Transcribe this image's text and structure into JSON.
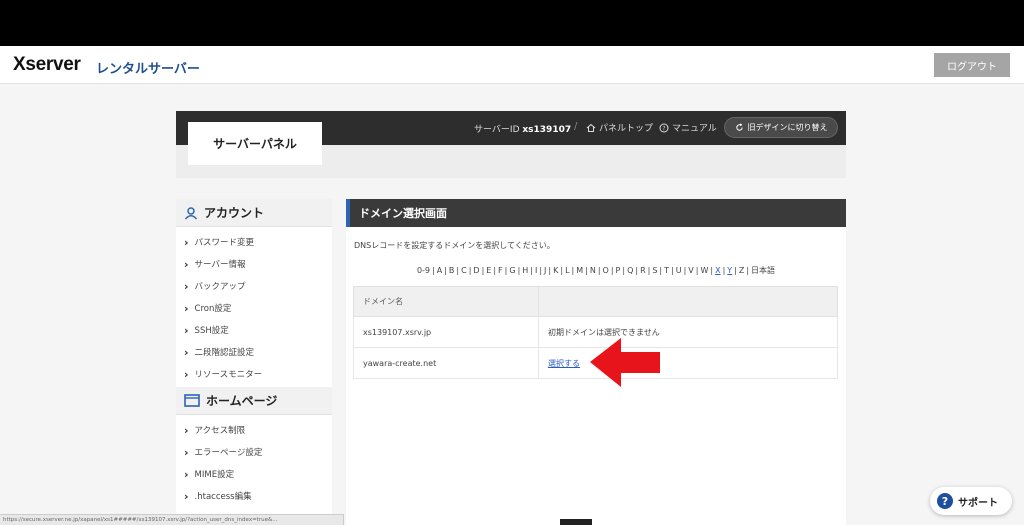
{
  "header": {
    "logo_main": "Xserver",
    "logo_sub": "レンタルサーバー",
    "logout_label": "ログアウト"
  },
  "panel": {
    "tab_label": "サーバーパネル",
    "server_id_label": "サーバーID",
    "server_id_value": "xs139107",
    "separator": "/",
    "panel_top_label": "パネルトップ",
    "manual_label": "マニュアル",
    "old_design_label": "旧デザインに切り替え"
  },
  "sidebar": {
    "account_heading": "アカウント",
    "account_items": [
      "パスワード変更",
      "サーバー情報",
      "バックアップ",
      "Cron設定",
      "SSH設定",
      "二段階認証設定",
      "リソースモニター"
    ],
    "homepage_heading": "ホームページ",
    "homepage_items": [
      "アクセス制限",
      "エラーページ設定",
      "MIME設定",
      ".htaccess編集"
    ]
  },
  "content": {
    "title": "ドメイン選択画面",
    "instruction": "DNSレコードを設定するドメインを選択してください。",
    "alpha_index": [
      "0-9",
      "A",
      "B",
      "C",
      "D",
      "E",
      "F",
      "G",
      "H",
      "I",
      "J",
      "K",
      "L",
      "M",
      "N",
      "O",
      "P",
      "Q",
      "R",
      "S",
      "T",
      "U",
      "V",
      "W",
      "X",
      "Y",
      "Z",
      "日本語"
    ],
    "alpha_selected": [
      "X",
      "Y"
    ],
    "table_header": [
      "ドメイン名",
      ""
    ],
    "rows": [
      {
        "domain": "xs139107.xsrv.jp",
        "action": "初期ドメインは選択できません",
        "is_link": false
      },
      {
        "domain": "yawara-create.net",
        "action": "選択する",
        "is_link": true
      }
    ]
  },
  "support": {
    "icon": "?",
    "label": "サポート"
  },
  "statusbar": {
    "url": "https://secure.xserver.ne.jp/xapanel/xs1#####/xs139107.xsrv.jp/?action_user_dns_index=true&..."
  },
  "colors": {
    "accent_blue": "#2d63b4",
    "link_blue": "#2a5bbf",
    "dark_bar": "#2d2d2d",
    "arrow_red": "#e8141b"
  }
}
